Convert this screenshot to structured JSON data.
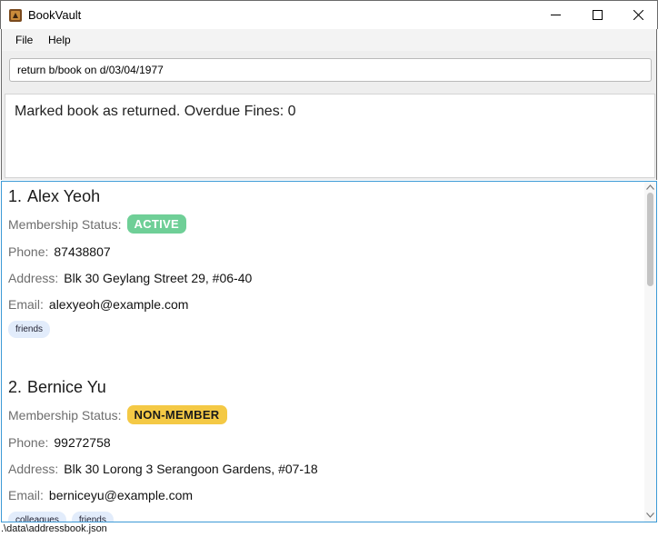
{
  "window": {
    "title": "BookVault",
    "icon": "app-icon"
  },
  "menu": {
    "file_label": "File",
    "help_label": "Help"
  },
  "command": {
    "value": "return b/book on d/03/04/1977"
  },
  "result": {
    "message": "Marked book as returned. Overdue Fines: 0"
  },
  "labels": {
    "membership_status": "Membership Status:",
    "phone": "Phone:",
    "address": "Address:",
    "email": "Email:"
  },
  "persons": [
    {
      "index": "1.",
      "name": "Alex Yeoh",
      "membership": "ACTIVE",
      "membership_color": "#6fcf97",
      "phone": "87438807",
      "address": "Blk 30 Geylang Street 29, #06-40",
      "email": "alexyeoh@example.com",
      "tags": [
        "friends"
      ]
    },
    {
      "index": "2.",
      "name": "Bernice Yu",
      "membership": "NON-MEMBER",
      "membership_color": "#f4c945",
      "phone": "99272758",
      "address": "Blk 30 Lorong 3 Serangoon Gardens, #07-18",
      "email": "berniceyu@example.com",
      "tags": [
        "colleagues",
        "friends"
      ]
    }
  ],
  "status": {
    "file_path": ".\\data\\addressbook.json"
  },
  "colors": {
    "list_border": "#3c9ad6",
    "tag_bg": "#e2ecfb"
  }
}
